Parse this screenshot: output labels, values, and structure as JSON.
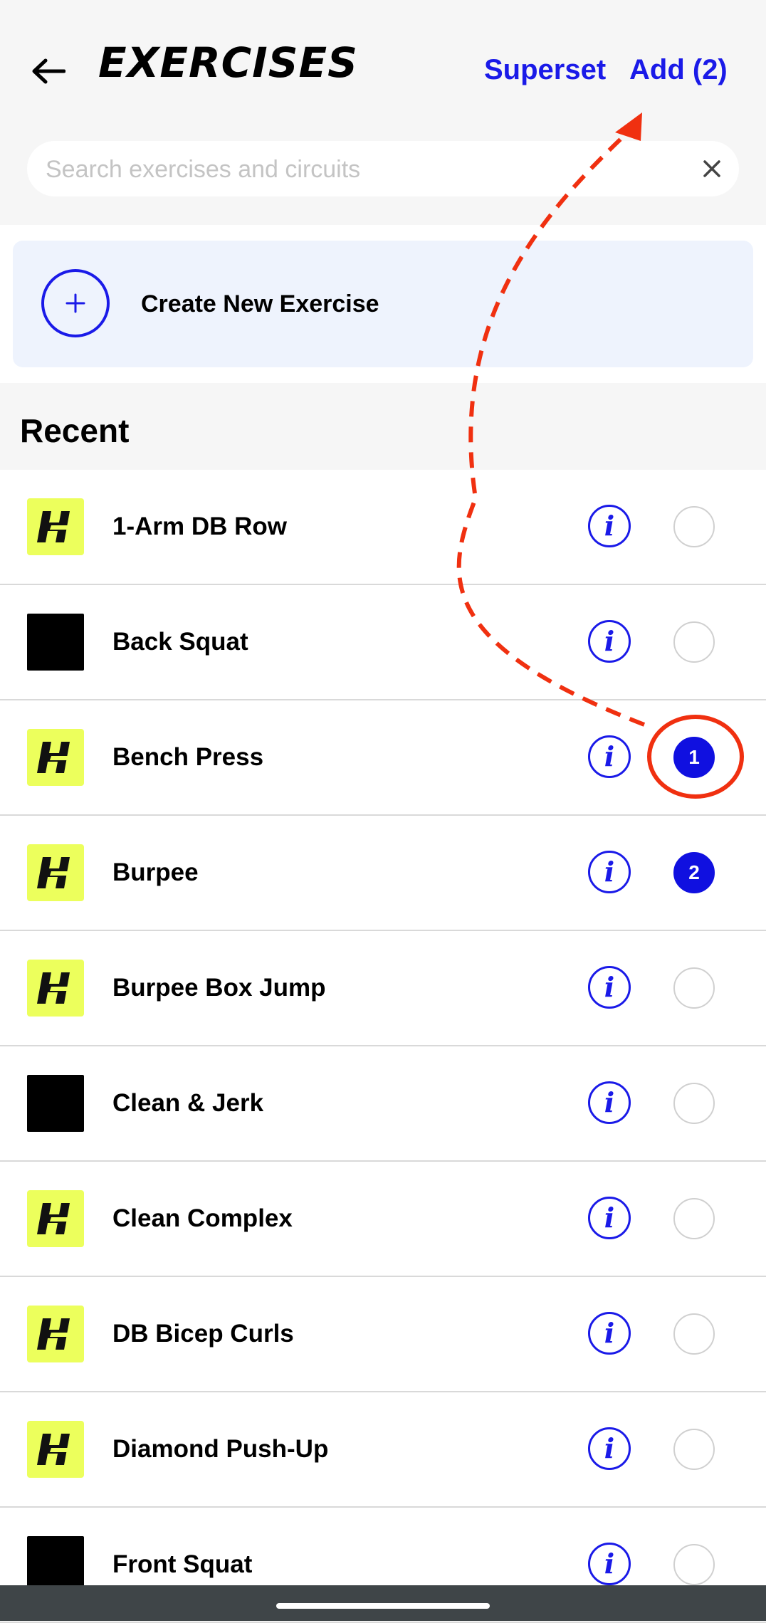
{
  "header": {
    "title": "EXERCISES",
    "superset_label": "Superset",
    "add_label": "Add (2)",
    "back_icon": "arrow-left-icon"
  },
  "search": {
    "placeholder": "Search exercises and circuits",
    "value": "",
    "clear_icon": "close-icon"
  },
  "create": {
    "label": "Create New Exercise",
    "icon": "plus-icon"
  },
  "recent": {
    "title": "Recent",
    "items": [
      {
        "name": "1-Arm DB Row",
        "thumb": "logo",
        "selected": ""
      },
      {
        "name": "Back Squat",
        "thumb": "blank",
        "selected": ""
      },
      {
        "name": "Bench Press",
        "thumb": "logo",
        "selected": "1"
      },
      {
        "name": "Burpee",
        "thumb": "logo",
        "selected": "2"
      },
      {
        "name": "Burpee Box Jump",
        "thumb": "logo",
        "selected": ""
      },
      {
        "name": "Clean & Jerk",
        "thumb": "blank",
        "selected": ""
      },
      {
        "name": "Clean Complex",
        "thumb": "logo",
        "selected": ""
      },
      {
        "name": "DB Bicep Curls",
        "thumb": "logo",
        "selected": ""
      },
      {
        "name": "Diamond Push-Up",
        "thumb": "logo",
        "selected": ""
      },
      {
        "name": "Front Squat",
        "thumb": "blank",
        "selected": ""
      }
    ]
  },
  "colors": {
    "accent": "#1a1ae8",
    "logo_bg": "#ecff5c",
    "annotation": "#f03010"
  }
}
